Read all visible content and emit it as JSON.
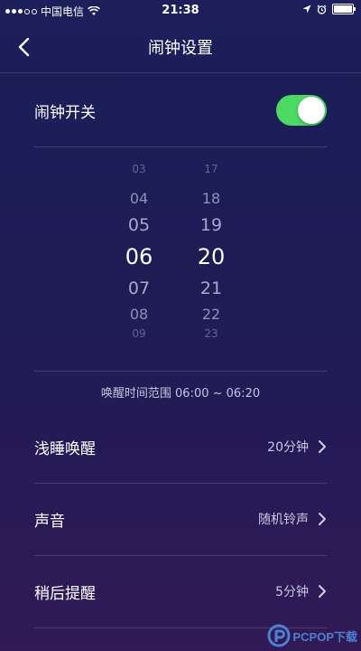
{
  "status_bar": {
    "carrier": "中国电信",
    "time": "21:38"
  },
  "nav": {
    "title": "闹钟设置"
  },
  "alarm_switch": {
    "label": "闹钟开关",
    "on": true,
    "on_color": "#4cd964"
  },
  "picker": {
    "hours": [
      "03",
      "04",
      "05",
      "06",
      "07",
      "08",
      "09"
    ],
    "minutes": [
      "17",
      "18",
      "19",
      "20",
      "21",
      "22",
      "23"
    ],
    "selected_hour": "06",
    "selected_minute": "20"
  },
  "wake_range": {
    "text": "唤醒时间范围 06:00 ~ 06:20"
  },
  "settings": [
    {
      "label": "浅睡唤醒",
      "value": "20分钟"
    },
    {
      "label": "声音",
      "value": "随机铃声"
    },
    {
      "label": "稍后提醒",
      "value": "5分钟"
    }
  ],
  "watermark": {
    "text": "PCPOP下载"
  }
}
